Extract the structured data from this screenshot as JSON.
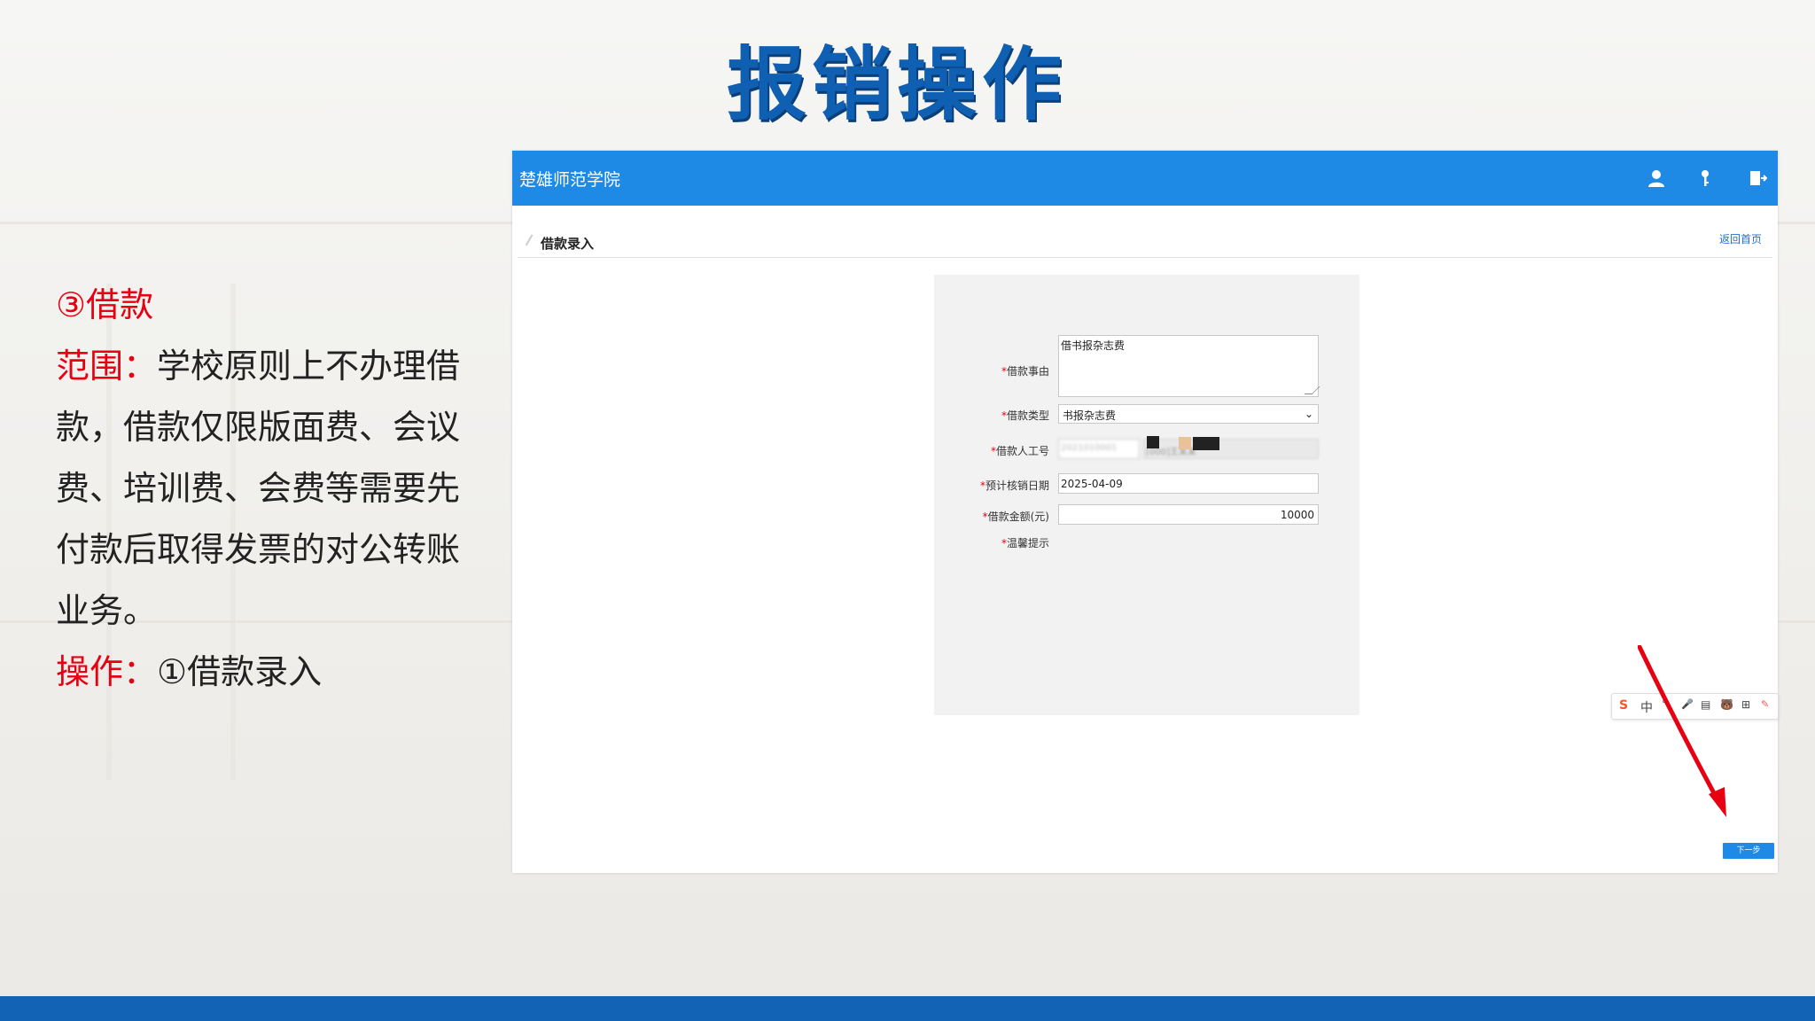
{
  "slide": {
    "title": "报销操作",
    "section": "③借款",
    "scope_label": "范围：",
    "scope_text": "学校原则上不办理借款，借款仅限版面费、会议费、培训费、会费等需要先付款后取得发票的对公转账业务。",
    "op_label": "操作：",
    "op_text": "①借款录入"
  },
  "app": {
    "name": "楚雄师范学院",
    "icons": [
      "user-icon",
      "key-icon",
      "logout-icon"
    ],
    "page_title": "借款录入",
    "home_link": "返回首页"
  },
  "form": {
    "reason": {
      "label": "借款事由",
      "value": "借书报杂志费"
    },
    "type": {
      "label": "借款类型",
      "value": "书报杂志费"
    },
    "employee": {
      "label": "借款人工号",
      "id_value": "2021010001",
      "name_value": "[000]王某某"
    },
    "date": {
      "label": "预计核销日期",
      "value": "2025-04-09"
    },
    "amount": {
      "label": "借款金额(元)",
      "value": "10000"
    },
    "tip": {
      "label": "温馨提示"
    }
  },
  "ime": {
    "items": [
      "S",
      "中",
      "°,",
      "🎤",
      "▤",
      "🐻",
      "⊞",
      "✎"
    ]
  },
  "actions": {
    "next": "下一步"
  },
  "colors": {
    "brand_blue": "#1f8ae6",
    "title_blue": "#0f5fb3",
    "accent_red": "#e60012",
    "bottom_bar": "#1263b6"
  }
}
